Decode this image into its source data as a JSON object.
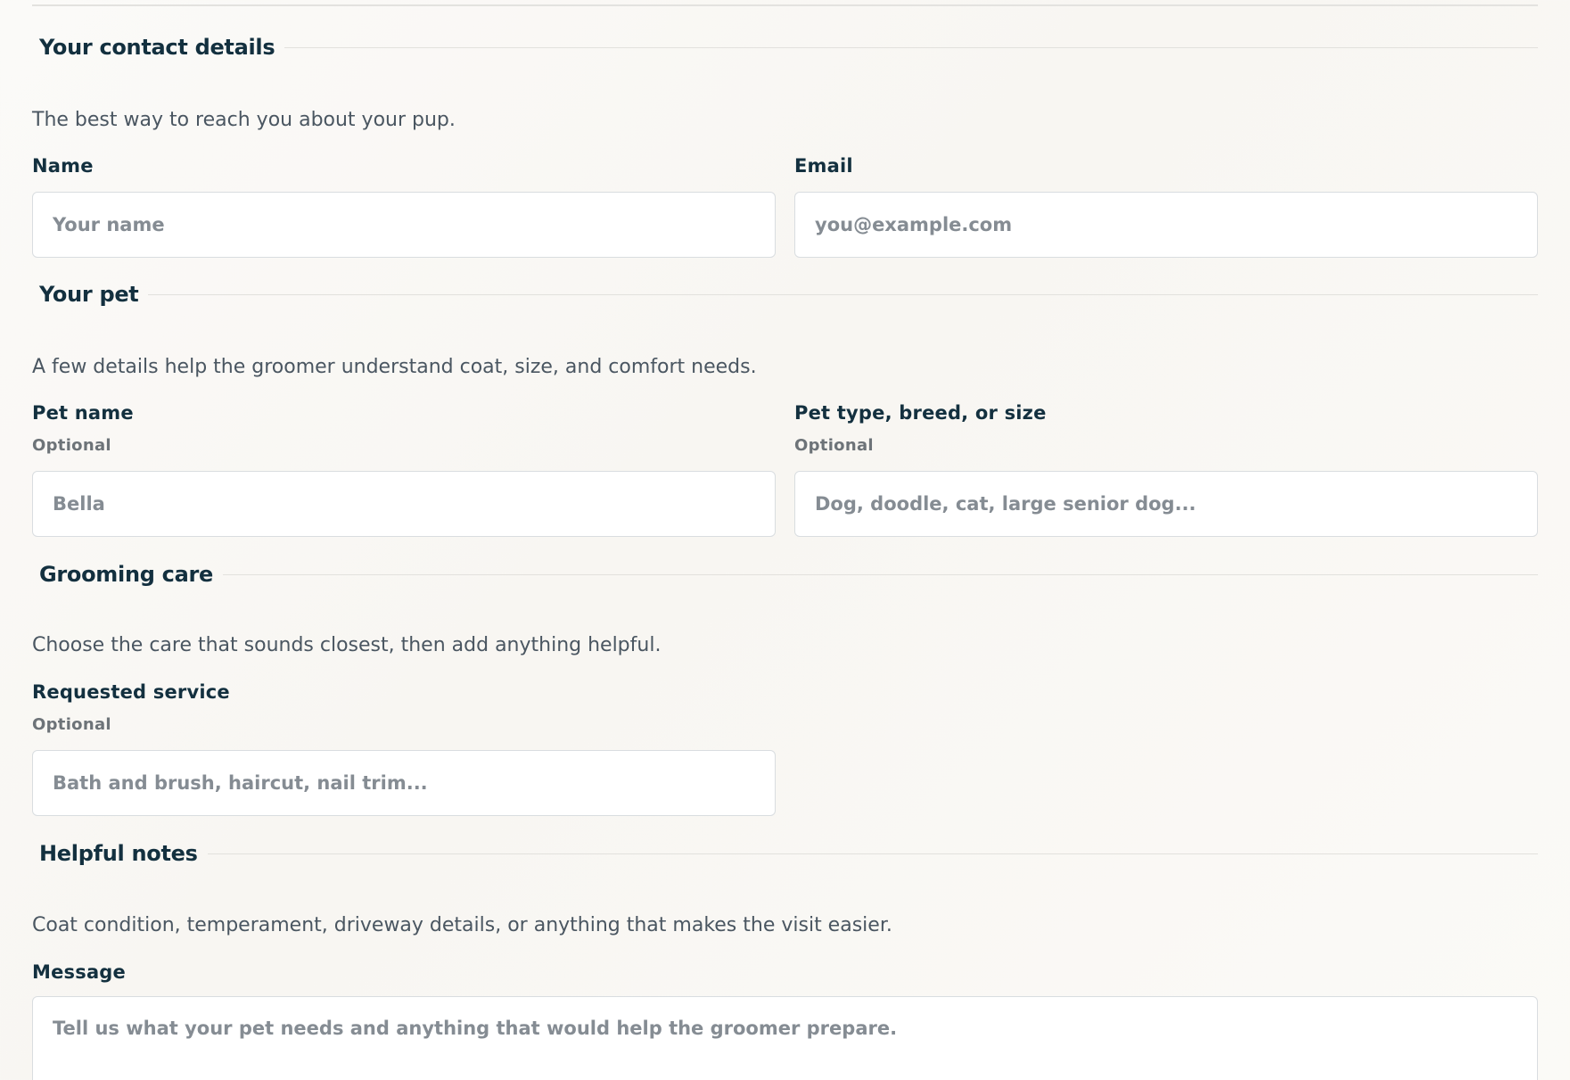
{
  "contact": {
    "title": "Your contact details",
    "description": "The best way to reach you about your pup.",
    "name_label": "Name",
    "name_placeholder": "Your name",
    "name_value": "",
    "email_label": "Email",
    "email_placeholder": "you@example.com",
    "email_value": ""
  },
  "pet": {
    "title": "Your pet",
    "description": "A few details help the groomer understand coat, size, and comfort needs.",
    "pet_name_label": "Pet name",
    "pet_name_hint": "Optional",
    "pet_name_placeholder": "Bella",
    "pet_name_value": "",
    "pet_type_label": "Pet type, breed, or size",
    "pet_type_hint": "Optional",
    "pet_type_placeholder": "Dog, doodle, cat, large senior dog...",
    "pet_type_value": ""
  },
  "grooming": {
    "title": "Grooming care",
    "description": "Choose the care that sounds closest, then add anything helpful.",
    "service_label": "Requested service",
    "service_hint": "Optional",
    "service_placeholder": "Bath and brush, haircut, nail trim...",
    "service_value": ""
  },
  "notes": {
    "title": "Helpful notes",
    "description": "Coat condition, temperament, driveway details, or anything that makes the visit easier.",
    "message_label": "Message",
    "message_placeholder": "Tell us what your pet needs and anything that would help the groomer prepare.",
    "message_value": ""
  }
}
